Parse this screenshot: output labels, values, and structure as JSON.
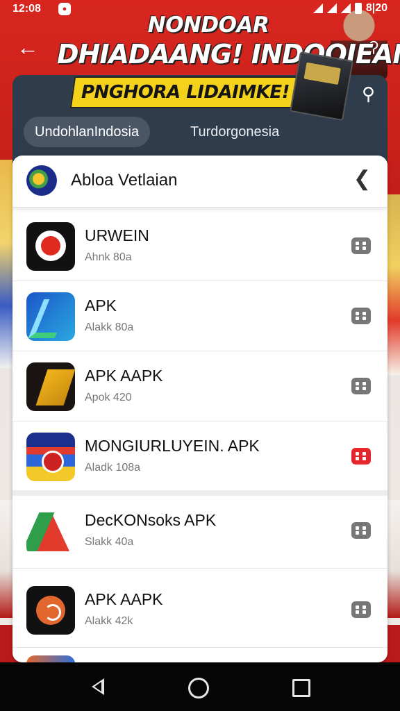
{
  "status_bar": {
    "time": "12:08",
    "battery_text": "8|20"
  },
  "banner": {
    "line1": "NONDOAR",
    "line2": "DHIADAANG! INDOQIEAN",
    "line3": "PNGHORA LIDAIMKE!"
  },
  "tabs": [
    {
      "label": "UndohlanIndosia",
      "active": true
    },
    {
      "label": "Turdorgonesia",
      "active": false
    }
  ],
  "list_header": {
    "title": "Abloa Vetlaian"
  },
  "apps": [
    {
      "name": "URWEIN",
      "sub": "Ahnk 80a",
      "icon": "red-circle-app-icon",
      "button_color": "#777777"
    },
    {
      "name": "APK",
      "sub": "Alakk 80a",
      "icon": "blue-a-app-icon",
      "button_color": "#777777"
    },
    {
      "name": "APK AAPK",
      "sub": "Apok 420",
      "icon": "gold-app-icon",
      "button_color": "#777777"
    },
    {
      "name": "MONGIURLUYEIN. APK",
      "sub": "Aladk 108a",
      "icon": "colorful-media-app-icon",
      "button_color": "#e4272b"
    },
    {
      "name": "DecKONsoks APK",
      "sub": "Slakk 40a",
      "icon": "green-red-a-app-icon",
      "button_color": "#777777"
    },
    {
      "name": "APK AAPK",
      "sub": "Alakk 42k",
      "icon": "orange-circle-app-icon",
      "button_color": "#777777"
    }
  ],
  "colors": {
    "banner_red": "#d8261f",
    "panel_dark": "#2f3c4c",
    "accent_yellow": "#f4d21c",
    "download_active": "#e4272b"
  }
}
